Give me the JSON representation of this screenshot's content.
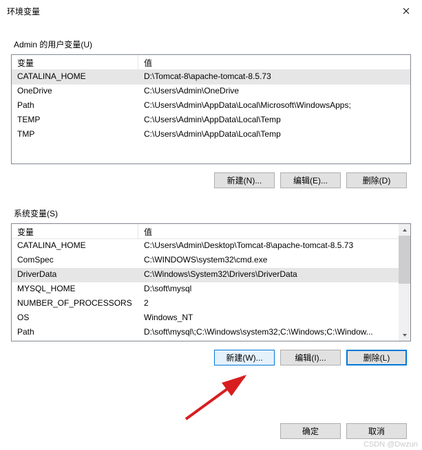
{
  "window": {
    "title": "环境变量"
  },
  "user_vars": {
    "label": "Admin 的用户变量(U)",
    "col_name": "变量",
    "col_value": "值",
    "rows": [
      {
        "name": "CATALINA_HOME",
        "value": "D:\\Tomcat-8\\apache-tomcat-8.5.73",
        "selected": true
      },
      {
        "name": "OneDrive",
        "value": "C:\\Users\\Admin\\OneDrive",
        "selected": false
      },
      {
        "name": "Path",
        "value": "C:\\Users\\Admin\\AppData\\Local\\Microsoft\\WindowsApps;",
        "selected": false
      },
      {
        "name": "TEMP",
        "value": "C:\\Users\\Admin\\AppData\\Local\\Temp",
        "selected": false
      },
      {
        "name": "TMP",
        "value": "C:\\Users\\Admin\\AppData\\Local\\Temp",
        "selected": false
      }
    ],
    "buttons": {
      "new": "新建(N)...",
      "edit": "编辑(E)...",
      "delete": "删除(D)"
    }
  },
  "system_vars": {
    "label": "系统变量(S)",
    "col_name": "变量",
    "col_value": "值",
    "rows": [
      {
        "name": "CATALINA_HOME",
        "value": "C:\\Users\\Admin\\Desktop\\Tomcat-8\\apache-tomcat-8.5.73",
        "selected": false
      },
      {
        "name": "ComSpec",
        "value": "C:\\WINDOWS\\system32\\cmd.exe",
        "selected": false
      },
      {
        "name": "DriverData",
        "value": "C:\\Windows\\System32\\Drivers\\DriverData",
        "selected": true
      },
      {
        "name": "MYSQL_HOME",
        "value": "D:\\soft\\mysql",
        "selected": false
      },
      {
        "name": "NUMBER_OF_PROCESSORS",
        "value": "2",
        "selected": false
      },
      {
        "name": "OS",
        "value": "Windows_NT",
        "selected": false
      },
      {
        "name": "Path",
        "value": "D:\\soft\\mysql\\;C:\\Windows\\system32;C:\\Windows;C:\\Window...",
        "selected": false
      }
    ],
    "buttons": {
      "new": "新建(W)...",
      "edit": "编辑(I)...",
      "delete": "删除(L)"
    }
  },
  "dialog_buttons": {
    "ok": "确定",
    "cancel": "取消"
  },
  "watermark": "CSDN @Dwzun"
}
